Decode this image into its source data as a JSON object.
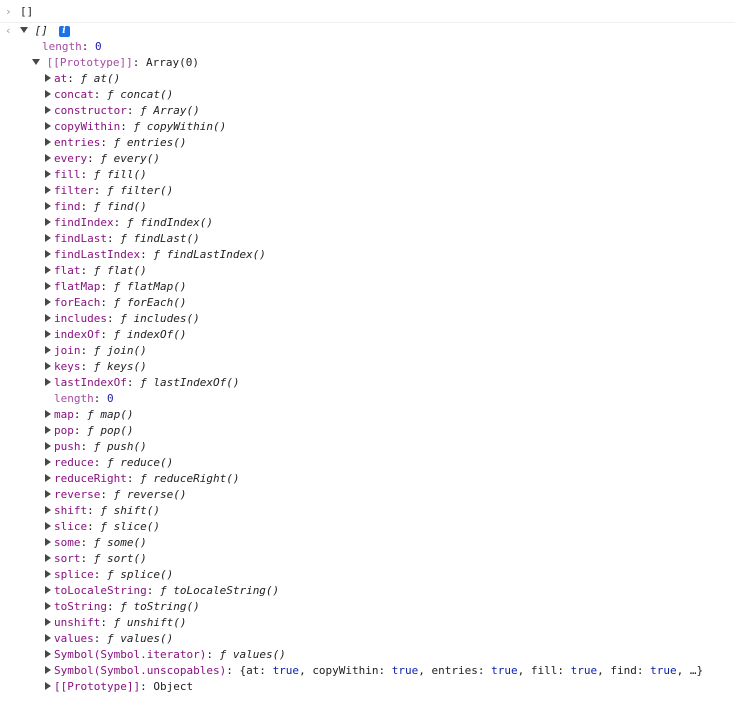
{
  "command": {
    "prompt_glyph": "›",
    "text": "[]"
  },
  "result": {
    "return_glyph": "‹",
    "summary": "[]",
    "info_glyph": "i"
  },
  "length_row": {
    "key": "length",
    "value": "0"
  },
  "prototype_row": {
    "key": "[[Prototype]]",
    "value": "Array(0)"
  },
  "methods": [
    {
      "key": "at",
      "fn": "at()"
    },
    {
      "key": "concat",
      "fn": "concat()"
    },
    {
      "key": "constructor",
      "fn": "Array()"
    },
    {
      "key": "copyWithin",
      "fn": "copyWithin()"
    },
    {
      "key": "entries",
      "fn": "entries()"
    },
    {
      "key": "every",
      "fn": "every()"
    },
    {
      "key": "fill",
      "fn": "fill()"
    },
    {
      "key": "filter",
      "fn": "filter()"
    },
    {
      "key": "find",
      "fn": "find()"
    },
    {
      "key": "findIndex",
      "fn": "findIndex()"
    },
    {
      "key": "findLast",
      "fn": "findLast()"
    },
    {
      "key": "findLastIndex",
      "fn": "findLastIndex()"
    },
    {
      "key": "flat",
      "fn": "flat()"
    },
    {
      "key": "flatMap",
      "fn": "flatMap()"
    },
    {
      "key": "forEach",
      "fn": "forEach()"
    },
    {
      "key": "includes",
      "fn": "includes()"
    },
    {
      "key": "indexOf",
      "fn": "indexOf()"
    },
    {
      "key": "join",
      "fn": "join()"
    },
    {
      "key": "keys",
      "fn": "keys()"
    },
    {
      "key": "lastIndexOf",
      "fn": "lastIndexOf()"
    },
    {
      "key": "length",
      "value": "0",
      "plain": true
    },
    {
      "key": "map",
      "fn": "map()"
    },
    {
      "key": "pop",
      "fn": "pop()"
    },
    {
      "key": "push",
      "fn": "push()"
    },
    {
      "key": "reduce",
      "fn": "reduce()"
    },
    {
      "key": "reduceRight",
      "fn": "reduceRight()"
    },
    {
      "key": "reverse",
      "fn": "reverse()"
    },
    {
      "key": "shift",
      "fn": "shift()"
    },
    {
      "key": "slice",
      "fn": "slice()"
    },
    {
      "key": "some",
      "fn": "some()"
    },
    {
      "key": "sort",
      "fn": "sort()"
    },
    {
      "key": "splice",
      "fn": "splice()"
    },
    {
      "key": "toLocaleString",
      "fn": "toLocaleString()"
    },
    {
      "key": "toString",
      "fn": "toString()"
    },
    {
      "key": "unshift",
      "fn": "unshift()"
    },
    {
      "key": "values",
      "fn": "values()"
    },
    {
      "key": "Symbol(Symbol.iterator)",
      "fn": "values()"
    },
    {
      "key": "Symbol(Symbol.unscopables)",
      "object_preview": [
        {
          "k": "at",
          "v": "true"
        },
        {
          "k": "copyWithin",
          "v": "true"
        },
        {
          "k": "entries",
          "v": "true"
        },
        {
          "k": "fill",
          "v": "true"
        },
        {
          "k": "find",
          "v": "true"
        }
      ],
      "ellipsis": "…"
    },
    {
      "key": "[[Prototype]]",
      "value": "Object",
      "plain_value": true
    }
  ],
  "function_glyph": "ƒ",
  "colors": {
    "key": "#881280",
    "dim_key": "#a54ca0",
    "boolean": "#0d22aa",
    "number": "#1a1aa6",
    "info_badge": "#1a73e8"
  }
}
